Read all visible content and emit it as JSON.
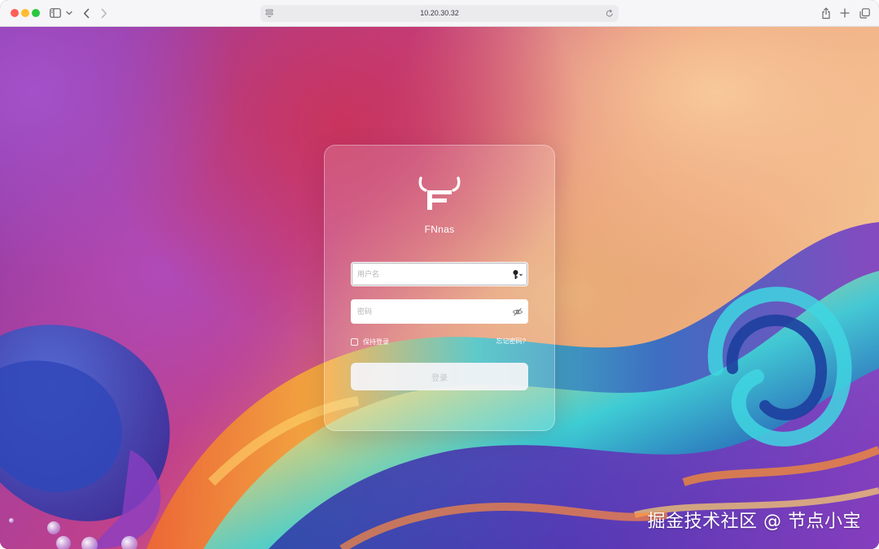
{
  "browser": {
    "address": "10.20.30.32"
  },
  "login": {
    "brand": "FNnas",
    "username_placeholder": "用户名",
    "password_placeholder": "密码",
    "remember_label": "保持登录",
    "forgot_label": "忘记密码?",
    "submit_label": "登录"
  },
  "watermark": "掘金技术社区 @ 节点小宝",
  "icons": {
    "toolbar": [
      "sidebar-icon",
      "chevron-down-icon",
      "back-icon",
      "forward-icon",
      "share-icon",
      "plus-icon",
      "tabs-overview-icon"
    ],
    "address": [
      "site-settings-icon",
      "reload-icon"
    ],
    "fields": [
      "key-icon",
      "eye-off-icon"
    ],
    "logo": "fnnas-bull-logo"
  },
  "colors": {
    "toolbar_bg": "#f6f5f7",
    "address_bg": "#ebebee",
    "traffic_red": "#fe5f57",
    "traffic_yellow": "#febc2e",
    "traffic_green": "#28c840",
    "login_button_bg": "#f4f4f8",
    "login_button_text": "#c6c6cc"
  }
}
